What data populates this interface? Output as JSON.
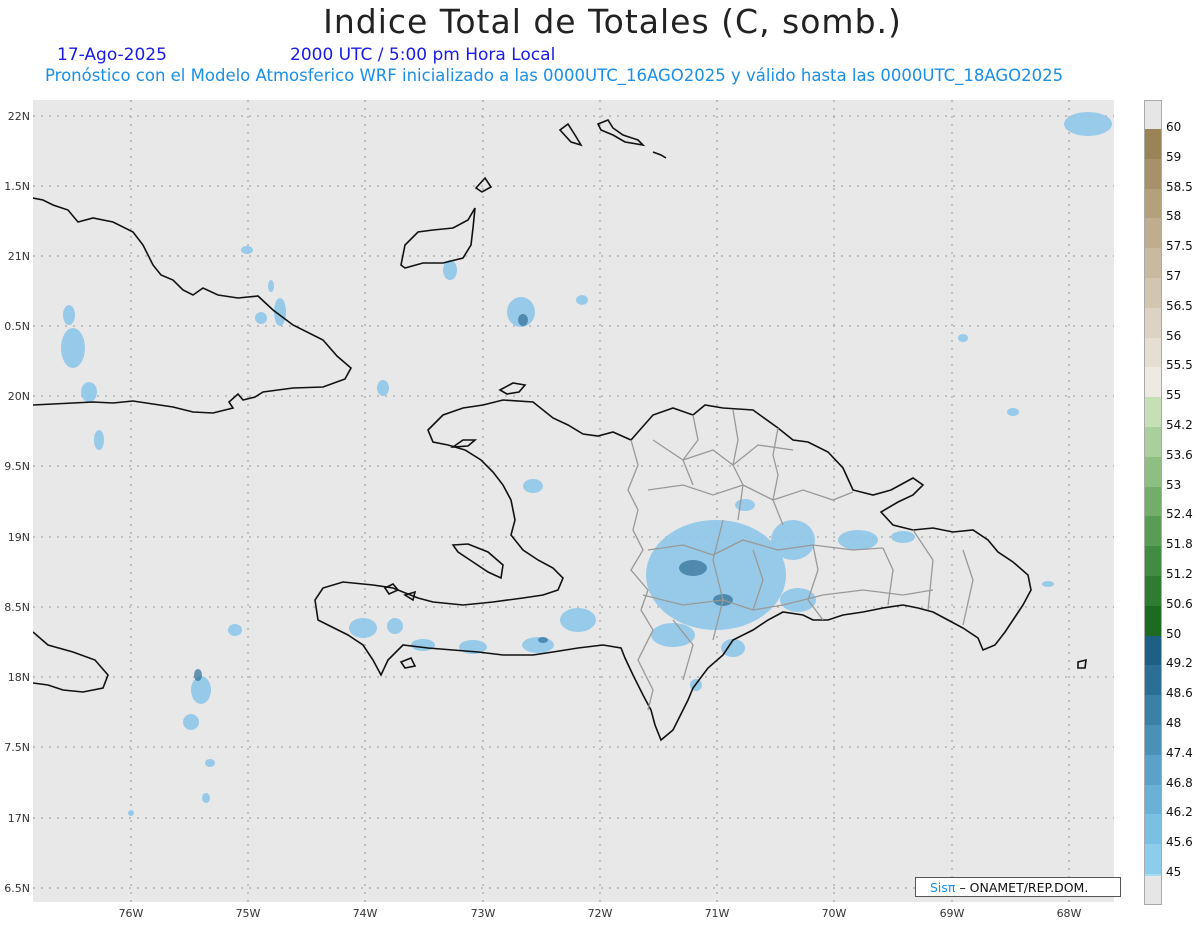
{
  "header": {
    "title": "Indice Total de Totales (C, somb.)",
    "date": "17-Ago-2025",
    "time": "2000 UTC / 5:00 pm Hora Local",
    "model_line": "Pronóstico con el Modelo Atmosferico WRF inicializado a las 0000UTC_16AGO2025 y válido hasta las  0000UTC_18AGO2025"
  },
  "axes": {
    "lat_labels": [
      "22N",
      "1.5N",
      "21N",
      "0.5N",
      "20N",
      "9.5N",
      "19N",
      "8.5N",
      "18N",
      "7.5N",
      "17N",
      "6.5N"
    ],
    "lon_labels": [
      "76W",
      "75W",
      "74W",
      "73W",
      "72W",
      "71W",
      "70W",
      "69W",
      "68W"
    ]
  },
  "colorbar": {
    "levels": [
      "60",
      "59",
      "58.5",
      "58",
      "57.5",
      "57",
      "56.5",
      "56",
      "55.5",
      "55",
      "54.2",
      "53.6",
      "53",
      "52.4",
      "51.8",
      "51.2",
      "50.6",
      "50",
      "49.2",
      "48.6",
      "48",
      "47.4",
      "46.8",
      "46.2",
      "45.6",
      "45"
    ],
    "colors": [
      "#9a8356",
      "#a8916a",
      "#b5a07c",
      "#bfad8e",
      "#c9ba9f",
      "#d2c6b0",
      "#dcd3c2",
      "#e5ded2",
      "#eeeae3",
      "#c4e0b4",
      "#a9d09a",
      "#8ebf82",
      "#73ad6a",
      "#599c53",
      "#428c41",
      "#2f7c31",
      "#1c6b21",
      "#1e5f86",
      "#2b6f96",
      "#3a80a7",
      "#4a91b8",
      "#5aa2c9",
      "#6ab1d7",
      "#7ac0e3",
      "#8dcdec",
      "#a6dbf4"
    ]
  },
  "credit": {
    "sis": "Sisπ",
    "rest": "– ONAMET/REP.DOM."
  }
}
